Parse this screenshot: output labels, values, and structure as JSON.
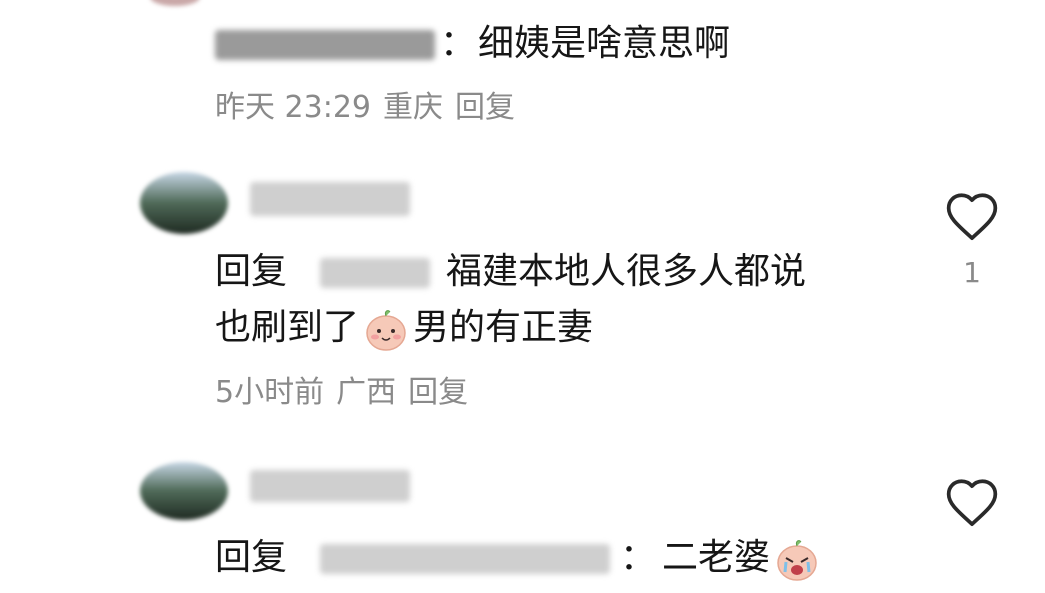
{
  "comments": [
    {
      "text": "细姨是啥意思啊",
      "colon": "：",
      "time": "昨天 23:29",
      "location": "重庆",
      "reply_label": "回复"
    },
    {
      "reply_prefix": "回复",
      "text_line1": "福建本地人很多人都说",
      "text_line2_a": "也刷到了",
      "text_line2_b": "男的有正妻",
      "emoji": "smile-emoji",
      "time": "5小时前",
      "location": "广西",
      "reply_label": "回复",
      "likes": "1"
    },
    {
      "reply_prefix": "回复",
      "colon": "：",
      "text": "二老婆",
      "emoji": "cry-emoji"
    }
  ],
  "icons": {
    "like": "heart-outline-icon"
  },
  "colors": {
    "text": "#161616",
    "meta": "#8a8a8a",
    "emoji_face": "#f6c9b8"
  }
}
